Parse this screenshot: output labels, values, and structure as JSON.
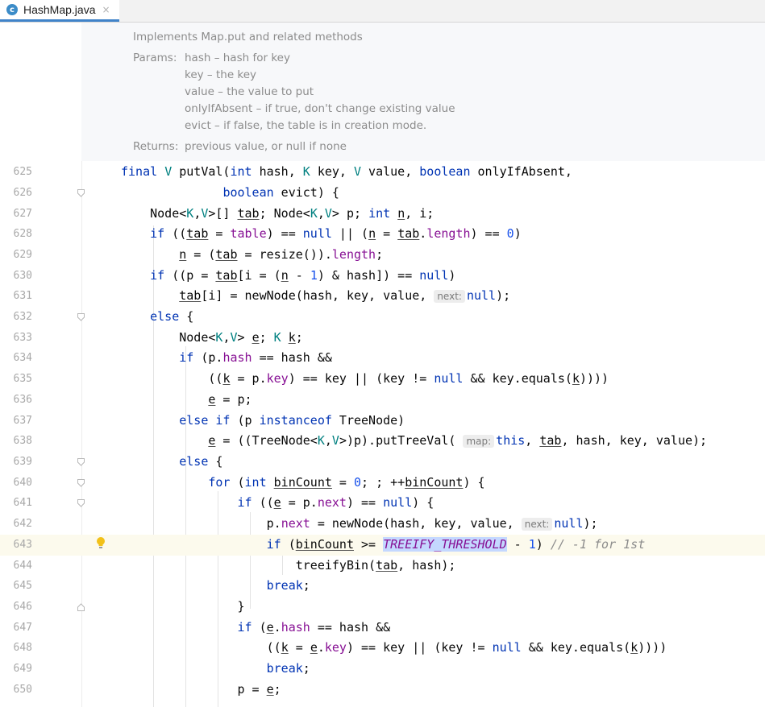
{
  "tab": {
    "label": "HashMap.java",
    "icon": "java-class-icon",
    "close": "×"
  },
  "doc": {
    "summary": "Implements Map.put and related methods",
    "params_label": "Params:",
    "params": [
      "hash – hash for key",
      "key – the key",
      "value – the value to put",
      "onlyIfAbsent – if true, don't change existing value",
      "evict – if false, the table is in creation mode."
    ],
    "returns_label": "Returns:",
    "returns": "previous value, or null if none"
  },
  "line_numbers": [
    "625",
    "626",
    "627",
    "628",
    "629",
    "630",
    "631",
    "632",
    "633",
    "634",
    "635",
    "636",
    "637",
    "638",
    "639",
    "640",
    "641",
    "642",
    "643",
    "644",
    "645",
    "646",
    "647",
    "648",
    "649",
    "650"
  ],
  "hints": {
    "next": "next:",
    "map": "map:"
  },
  "highlight_color": "#c4d8ff",
  "current_line_color": "#fcfaed"
}
